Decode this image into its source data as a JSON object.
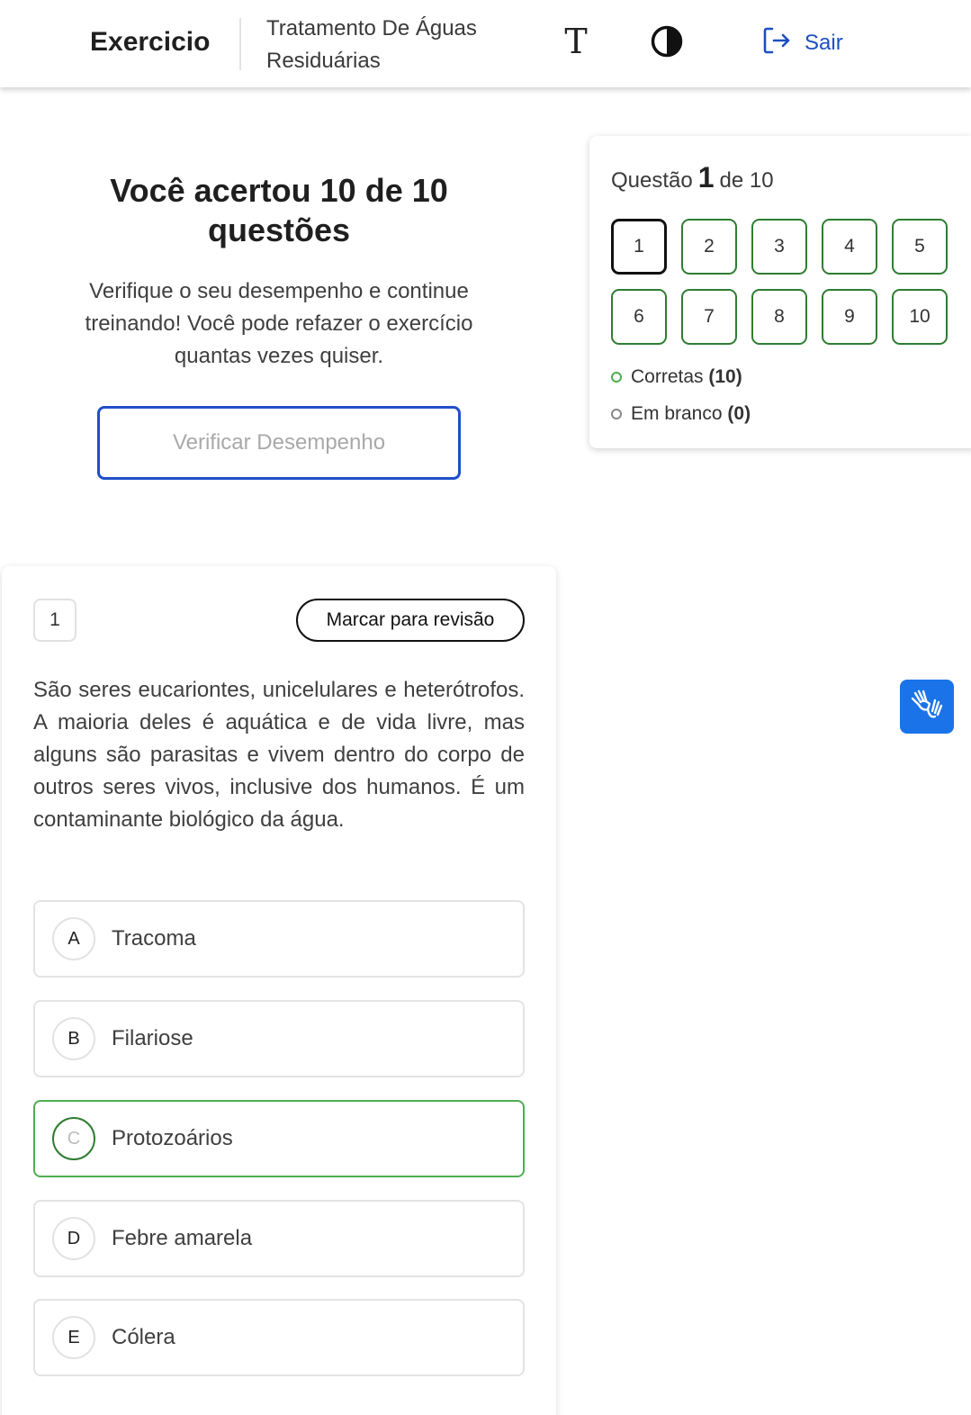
{
  "header": {
    "brand": "Exercicio",
    "subject_line1": "Tratamento De Águas",
    "subject_line2": "Residuárias",
    "font_icon_glyph": "T",
    "logout_label": "Sair",
    "icons": [
      "font-size-icon",
      "contrast-icon",
      "logout-icon"
    ]
  },
  "result": {
    "title": "Você acertou 10 de 10 questões",
    "description": "Verifique o seu desempenho e continue treinando! Você pode refazer o exercício quantas vezes quiser.",
    "button_label": "Verificar Desempenho"
  },
  "navigator": {
    "prefix": "Questão",
    "current": "1",
    "suffix": "de 10",
    "questions": [
      "1",
      "2",
      "3",
      "4",
      "5",
      "6",
      "7",
      "8",
      "9",
      "10"
    ],
    "legend_correct_label": "Corretas",
    "legend_correct_count": "(10)",
    "legend_blank_label": "Em branco",
    "legend_blank_count": "(0)"
  },
  "question": {
    "number": "1",
    "review_label": "Marcar para revisão",
    "text": "São seres eucariontes, unicelulares e heterótrofos. A maioria deles é aquática e de vida livre, mas alguns são parasitas e vivem dentro do corpo de outros seres vivos, inclusive dos humanos. É um contaminante biológico da água.",
    "options": [
      {
        "letter": "A",
        "text": "Tracoma",
        "correct": false
      },
      {
        "letter": "B",
        "text": "Filariose",
        "correct": false
      },
      {
        "letter": "C",
        "text": "Protozoários",
        "correct": true
      },
      {
        "letter": "D",
        "text": "Febre amarela",
        "correct": false
      },
      {
        "letter": "E",
        "text": "Cólera",
        "correct": false
      }
    ]
  },
  "colors": {
    "accent_blue": "#1f4fc9",
    "correct_green": "#4caf50",
    "libras_blue": "#1a73e8"
  }
}
